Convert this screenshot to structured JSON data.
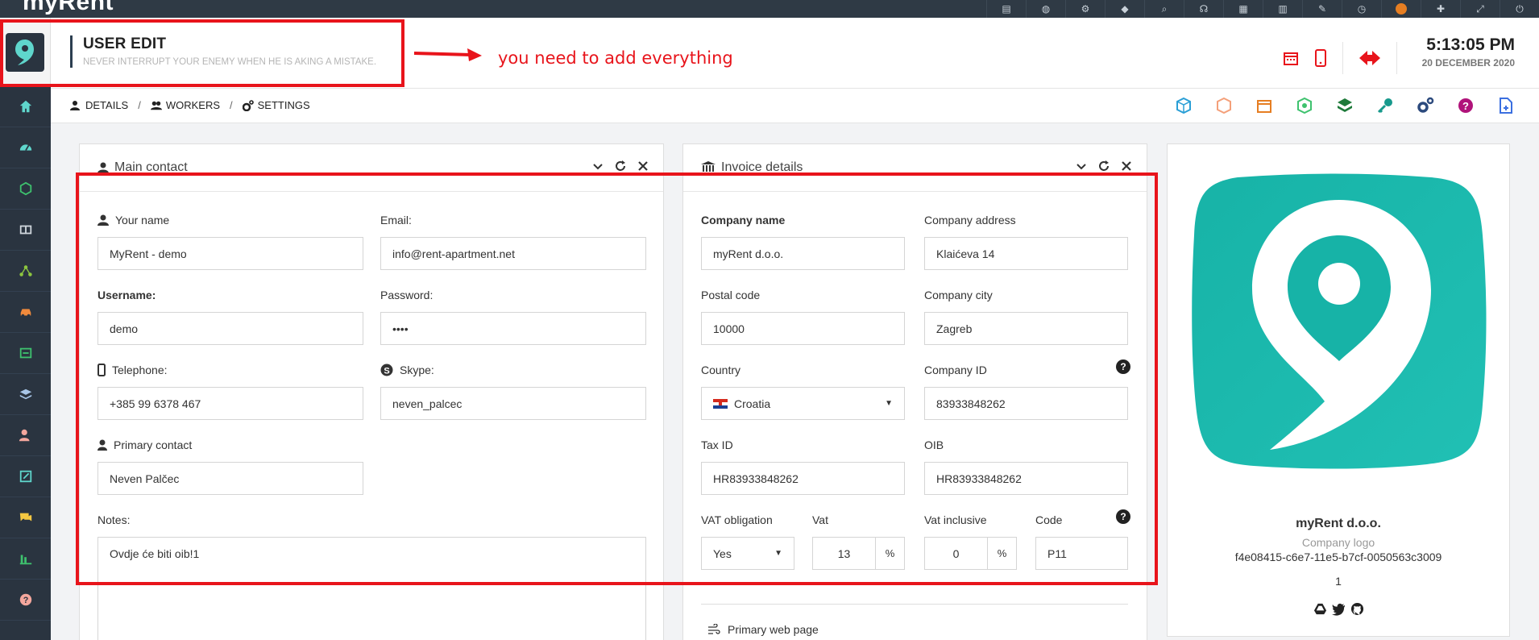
{
  "app": {
    "name": "myRent"
  },
  "header": {
    "title": "USER EDIT",
    "motto": "NEVER INTERRUPT YOUR ENEMY WHEN HE IS AKING A MISTAKE.",
    "time": "5:13:05 PM",
    "date": "20 DECEMBER 2020"
  },
  "annotation": {
    "text": "you need to add everything"
  },
  "breadcrumb": {
    "details": "DETAILS",
    "workers": "WORKERS",
    "settings": "SETTINGS"
  },
  "main_contact": {
    "title": "Main contact",
    "your_name_label": "Your name",
    "your_name": "MyRent - demo",
    "email_label": "Email:",
    "email": "info@rent-apartment.net",
    "username_label": "Username:",
    "username": "demo",
    "password_label": "Password:",
    "password": "••••",
    "telephone_label": "Telephone:",
    "telephone": "+385 99 6378 467",
    "skype_label": "Skype:",
    "skype": "neven_palcec",
    "primary_contact_label": "Primary contact",
    "primary_contact": "Neven Palčec",
    "notes_label": "Notes:",
    "notes": "Ovdje će biti oib!1"
  },
  "invoice": {
    "title": "Invoice details",
    "company_name_label": "Company name",
    "company_name": "myRent d.o.o.",
    "company_address_label": "Company address",
    "company_address": "Klaićeva 14",
    "postal_code_label": "Postal code",
    "postal_code": "10000",
    "company_city_label": "Company city",
    "company_city": "Zagreb",
    "country_label": "Country",
    "country": "Croatia",
    "company_id_label": "Company ID",
    "company_id": "83933848262",
    "tax_id_label": "Tax ID",
    "tax_id": "HR83933848262",
    "oib_label": "OIB",
    "oib": "HR83933848262",
    "vat_obligation_label": "VAT obligation",
    "vat_obligation": "Yes",
    "vat_label": "Vat",
    "vat": "13",
    "vat_inclusive_label": "Vat inclusive",
    "vat_inclusive": "0",
    "percent": "%",
    "code_label": "Code",
    "code": "P11",
    "web_label": "Primary web page"
  },
  "logo_panel": {
    "company_name": "myRent d.o.o.",
    "label": "Company logo",
    "id": "f4e08415-c6e7-11e5-b7cf-0050563c3009",
    "number": "1"
  },
  "colors": {
    "accent": "#1ab1a8",
    "annotation": "#e8141b",
    "sidebar": "#2a3440"
  }
}
